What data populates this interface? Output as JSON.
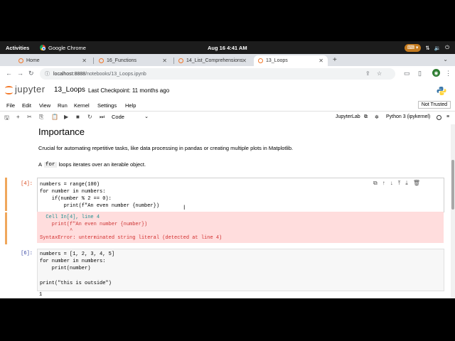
{
  "system": {
    "activities": "Activities",
    "app_name": "Google Chrome",
    "clock": "Aug 16  4:41 AM"
  },
  "browser": {
    "tabs": [
      {
        "label": "Home",
        "active": false
      },
      {
        "label": "16_Functions",
        "active": false
      },
      {
        "label": "14_List_Comprehensions",
        "active": false
      },
      {
        "label": "13_Loops",
        "active": true
      }
    ],
    "url_host": "localhost:8888",
    "url_path": "/notebooks/13_Loops.ipynb"
  },
  "jupyter": {
    "logo_text": "jupyter",
    "notebook_title": "13_Loops",
    "checkpoint": "Last Checkpoint: 11 months ago",
    "menu": [
      "File",
      "Edit",
      "View",
      "Run",
      "Kernel",
      "Settings",
      "Help"
    ],
    "trusted": "Not Trusted",
    "cell_type": "Code",
    "jupyterlab_label": "JupyterLab",
    "kernel_label": "Python 3 (ipykernel)"
  },
  "content": {
    "heading": "Importance",
    "para1": "Crucial for automating repetitive tasks, like data processing in pandas or creating multiple plots in Matplotlib.",
    "para2_pre": "A",
    "para2_code": "for",
    "para2_post": "loops iterates over an iterable object."
  },
  "cell1": {
    "prompt": "[4]:",
    "lines": [
      "numbers = range(100)",
      "for number in numbers:",
      "    if(number % 2 == 0):",
      "        print(f\"An even number {number})"
    ],
    "error_lines": [
      "  Cell In[4], line 4",
      "    print(f\"An even number {number})",
      "          ^",
      "SyntaxError: unterminated string literal (detected at line 4)"
    ]
  },
  "cell2": {
    "prompt": "[6]:",
    "lines": [
      "numbers = [1, 2, 3, 4, 5]",
      "for number in numbers:",
      "    print(number)",
      "",
      "print(\"this is outside\")"
    ],
    "output_first": "1"
  }
}
